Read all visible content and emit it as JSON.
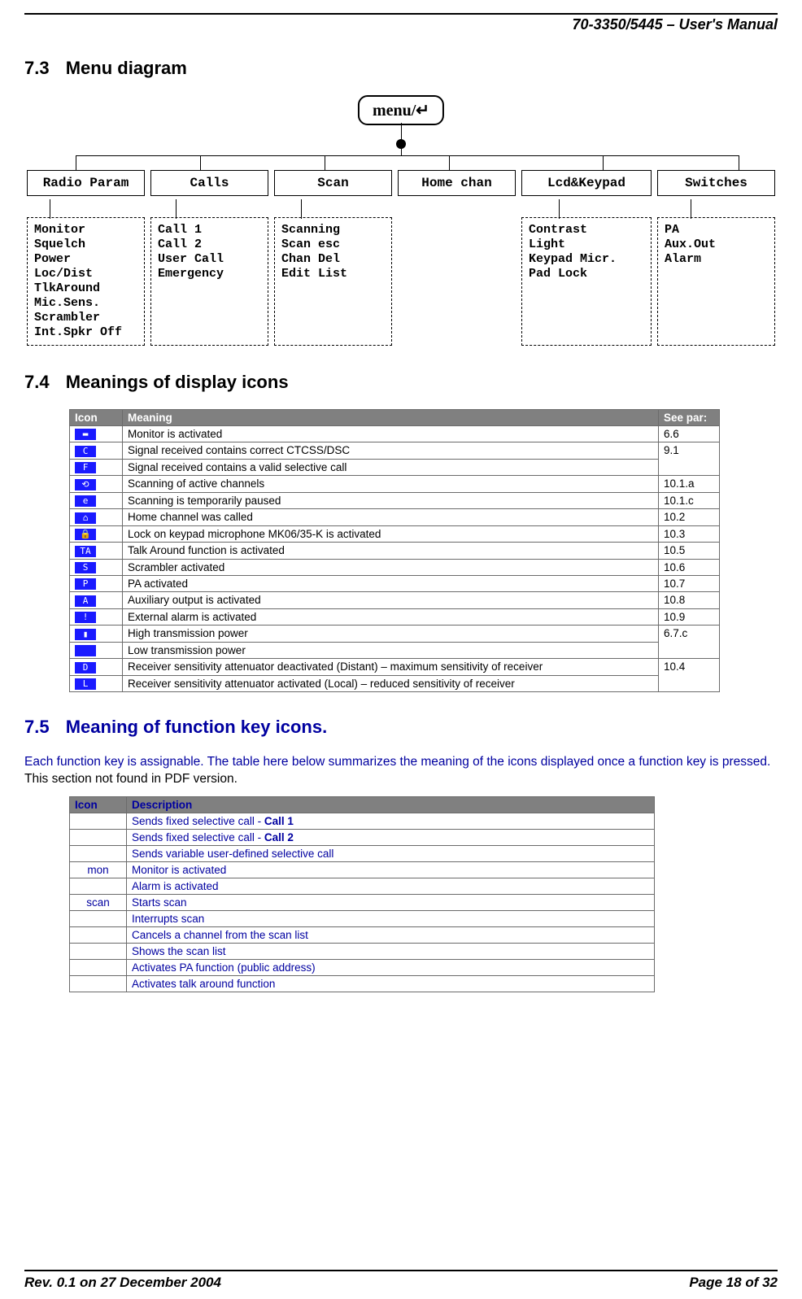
{
  "header": {
    "doc_id": "70-3350/5445 – User's Manual"
  },
  "sections": {
    "s73": {
      "num": "7.3",
      "title": "Menu diagram"
    },
    "s74": {
      "num": "7.4",
      "title": "Meanings of display icons"
    },
    "s75": {
      "num": "7.5",
      "title": "Meaning of function key icons."
    }
  },
  "diagram": {
    "root": "menu/↵",
    "cats": [
      "Radio Param",
      "Calls",
      "Scan",
      "Home chan",
      "Lcd&Keypad",
      "Switches"
    ],
    "subs": {
      "radio": "Monitor\nSquelch\nPower\nLoc/Dist\nTlkAround\nMic.Sens.\nScrambler\nInt.Spkr Off",
      "calls": "Call 1\nCall 2\nUser Call\nEmergency",
      "scan": "Scanning\nScan esc\nChan Del\nEdit List",
      "lcd": "Contrast\nLight\nKeypad Micr.\nPad Lock",
      "switches": "PA\nAux.Out\nAlarm"
    }
  },
  "table74": {
    "headers": {
      "icon": "Icon",
      "meaning": "Meaning",
      "see": "See par:"
    },
    "rows": [
      {
        "g": "▬",
        "m": "Monitor is activated",
        "s": "6.6"
      },
      {
        "g": "C",
        "m": "Signal received contains correct CTCSS/DSC",
        "s": "9.1"
      },
      {
        "g": "F",
        "m": "Signal received contains a valid selective call",
        "s": ""
      },
      {
        "g": "⟲",
        "m": "Scanning of active channels",
        "s": "10.1.a"
      },
      {
        "g": "e",
        "m": "Scanning is temporarily paused",
        "s": "10.1.c"
      },
      {
        "g": "⌂",
        "m": "Home channel was called",
        "s": "10.2"
      },
      {
        "g": "🔒",
        "m": "Lock on keypad microphone MK06/35-K is activated",
        "s": "10.3"
      },
      {
        "g": "TA",
        "m": "Talk Around function is activated",
        "s": "10.5"
      },
      {
        "g": "S",
        "m": "Scrambler activated",
        "s": "10.6"
      },
      {
        "g": "P",
        "m": "PA activated",
        "s": "10.7"
      },
      {
        "g": "A",
        "m": "Auxiliary output is activated",
        "s": "10.8"
      },
      {
        "g": "!",
        "m": "External alarm is activated",
        "s": "10.9"
      },
      {
        "g": "▮",
        "m": "High transmission power",
        "s": "6.7.c"
      },
      {
        "g": " ",
        "m": "Low transmission power",
        "s": ""
      },
      {
        "g": "D",
        "m": "Receiver sensitivity attenuator deactivated (Distant) – maximum sensitivity of receiver",
        "s": "10.4"
      },
      {
        "g": "L",
        "m": "Receiver sensitivity attenuator activated (Local) – reduced sensitivity of receiver",
        "s": ""
      }
    ]
  },
  "para75": {
    "lead": "Each function key is assignable. The  table here below summarizes the meaning of the icons displayed once a function key is pressed.  ",
    "note": "This section not found in PDF version."
  },
  "table75": {
    "headers": {
      "icon": "Icon",
      "desc": "Description"
    },
    "rows": [
      {
        "i": "",
        "d": "Sends fixed selective call - ",
        "b": "Call 1"
      },
      {
        "i": "",
        "d": "Sends fixed selective call - ",
        "b": "Call 2"
      },
      {
        "i": "",
        "d": "Sends variable user-defined selective call",
        "b": ""
      },
      {
        "i": "mon",
        "d": "Monitor is activated",
        "b": ""
      },
      {
        "i": "",
        "d": "Alarm is activated",
        "b": ""
      },
      {
        "i": "scan",
        "d": "Starts scan",
        "b": ""
      },
      {
        "i": "",
        "d": "Interrupts scan",
        "b": ""
      },
      {
        "i": "",
        "d": "Cancels a channel from the scan list",
        "b": ""
      },
      {
        "i": "",
        "d": "Shows the scan list",
        "b": ""
      },
      {
        "i": "",
        "d": "Activates PA function (public address)",
        "b": ""
      },
      {
        "i": "",
        "d": "Activates talk around function",
        "b": ""
      }
    ]
  },
  "footer": {
    "rev": "Rev. 0.1 on 27 December 2004",
    "page": "Page 18 of 32"
  }
}
